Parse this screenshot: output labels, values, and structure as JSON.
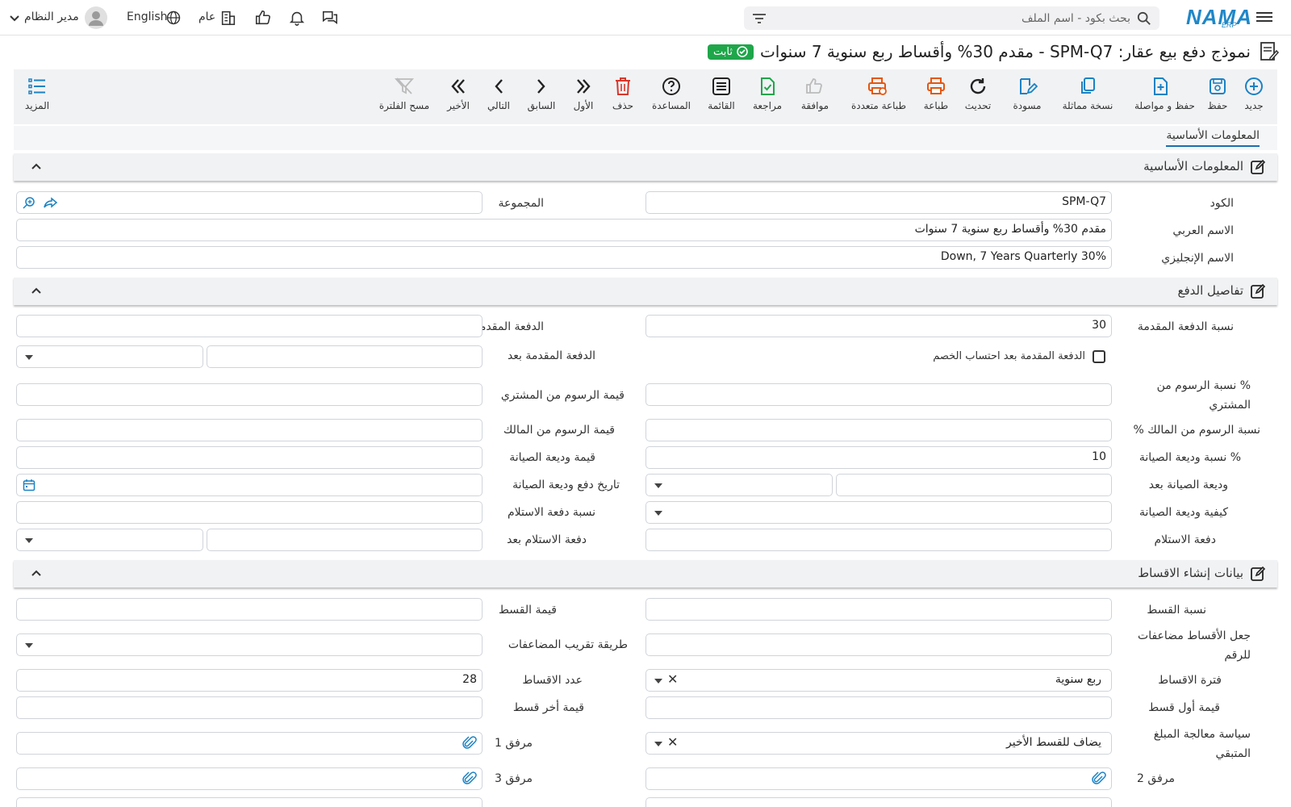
{
  "topbar": {
    "brand": "NAMA",
    "brand_sub": "ERP",
    "search_placeholder": "بحث بكود - اسم الملف",
    "user_name": "مدير النظام",
    "language": "English",
    "scope": "عام"
  },
  "title": {
    "text": "نموذج دفع بيع عقار: SPM-Q7 - مقدم 30% وأقساط ربع سنوية 7 سنوات",
    "status": "ثابت"
  },
  "toolbar": {
    "new": "جديد",
    "save": "حفظ",
    "save_continue": "حفظ و مواصلة",
    "duplicate": "نسخة مماثلة",
    "draft": "مسودة",
    "refresh": "تحديث",
    "print": "طباعة",
    "multi_print": "طباعة متعددة",
    "approve": "موافقة",
    "review": "مراجعة",
    "list": "القائمة",
    "help": "المساعدة",
    "delete": "حذف",
    "first": "الأول",
    "previous": "السابق",
    "next": "التالي",
    "last": "الأخير",
    "clear_filter": "مسح الفلترة",
    "more": "المزيد"
  },
  "tabs": {
    "basic": "المعلومات الأساسية"
  },
  "sections": {
    "basic": "المعلومات الأساسية",
    "payment": "تفاصيل الدفع",
    "installments": "بيانات إنشاء الاقساط"
  },
  "basic": {
    "code_label": "الكود",
    "code_value": "SPM-Q7",
    "group_label": "المجموعة",
    "arabic_name_label": "الاسم العربي",
    "arabic_name_value": "مقدم 30% وأقساط ربع سنوية 7 سنوات",
    "english_name_label": "الاسم الإنجليزي",
    "english_name_value": "Down, 7 Years Quarterly 30%"
  },
  "payment": {
    "down_pct_label": "نسبة الدفعة المقدمة",
    "down_pct_value": "30",
    "down_payment_label": "الدفعة المقدمة",
    "down_after_discount_label": "الدفعة المقدمة بعد احتساب الخصم",
    "down_after_label": "الدفعة المقدمة بعد",
    "buyer_fees_pct_label": "% نسبة الرسوم من المشتري",
    "buyer_fees_value_label": "قيمة الرسوم من المشتري",
    "owner_fees_pct_label": "نسبة الرسوم من المالك %",
    "owner_fees_value_label": "قيمة الرسوم من المالك",
    "maint_pct_label": "% نسبة وديعة الصيانة",
    "maint_pct_value": "10",
    "maint_value_label": "قيمة وديعة الصيانة",
    "maint_after_label": "وديعة الصيانة بعد",
    "maint_date_label": "تاريخ دفع وديعة الصيانة",
    "maint_method_label": "كيفية وديعة الصيانة",
    "handover_pct_label": "نسبة دفعة الاستلام",
    "handover_label": "دفعة الاستلام",
    "handover_after_label": "دفعة الاستلام بعد"
  },
  "installments": {
    "inst_pct_label": "نسبة القسط",
    "inst_value_label": "قيمة القسط",
    "multiples_label": "جعل الأقساط مضاعفات للرقم",
    "rounding_label": "طريقة تقريب المضاعفات",
    "period_label": "فترة الاقساط",
    "period_value": "ربع سنوية",
    "count_label": "عدد الاقساط",
    "count_value": "28",
    "first_inst_label": "قيمة أول قسط",
    "last_inst_label": "قيمة أخر قسط",
    "remaining_policy_label": "سياسة معالجة المبلغ المتبقي",
    "remaining_policy_value": "يضاف للقسط الأخير",
    "attachment1_label": "مرفق 1",
    "attachment2_label": "مرفق 2",
    "attachment3_label": "مرفق 3"
  },
  "colors": {
    "accent": "#1a6fb0",
    "status_green": "#1fa64a",
    "delete_red": "#d9362b",
    "print_orange": "#e4570e",
    "save_blue": "#1a82c4"
  }
}
